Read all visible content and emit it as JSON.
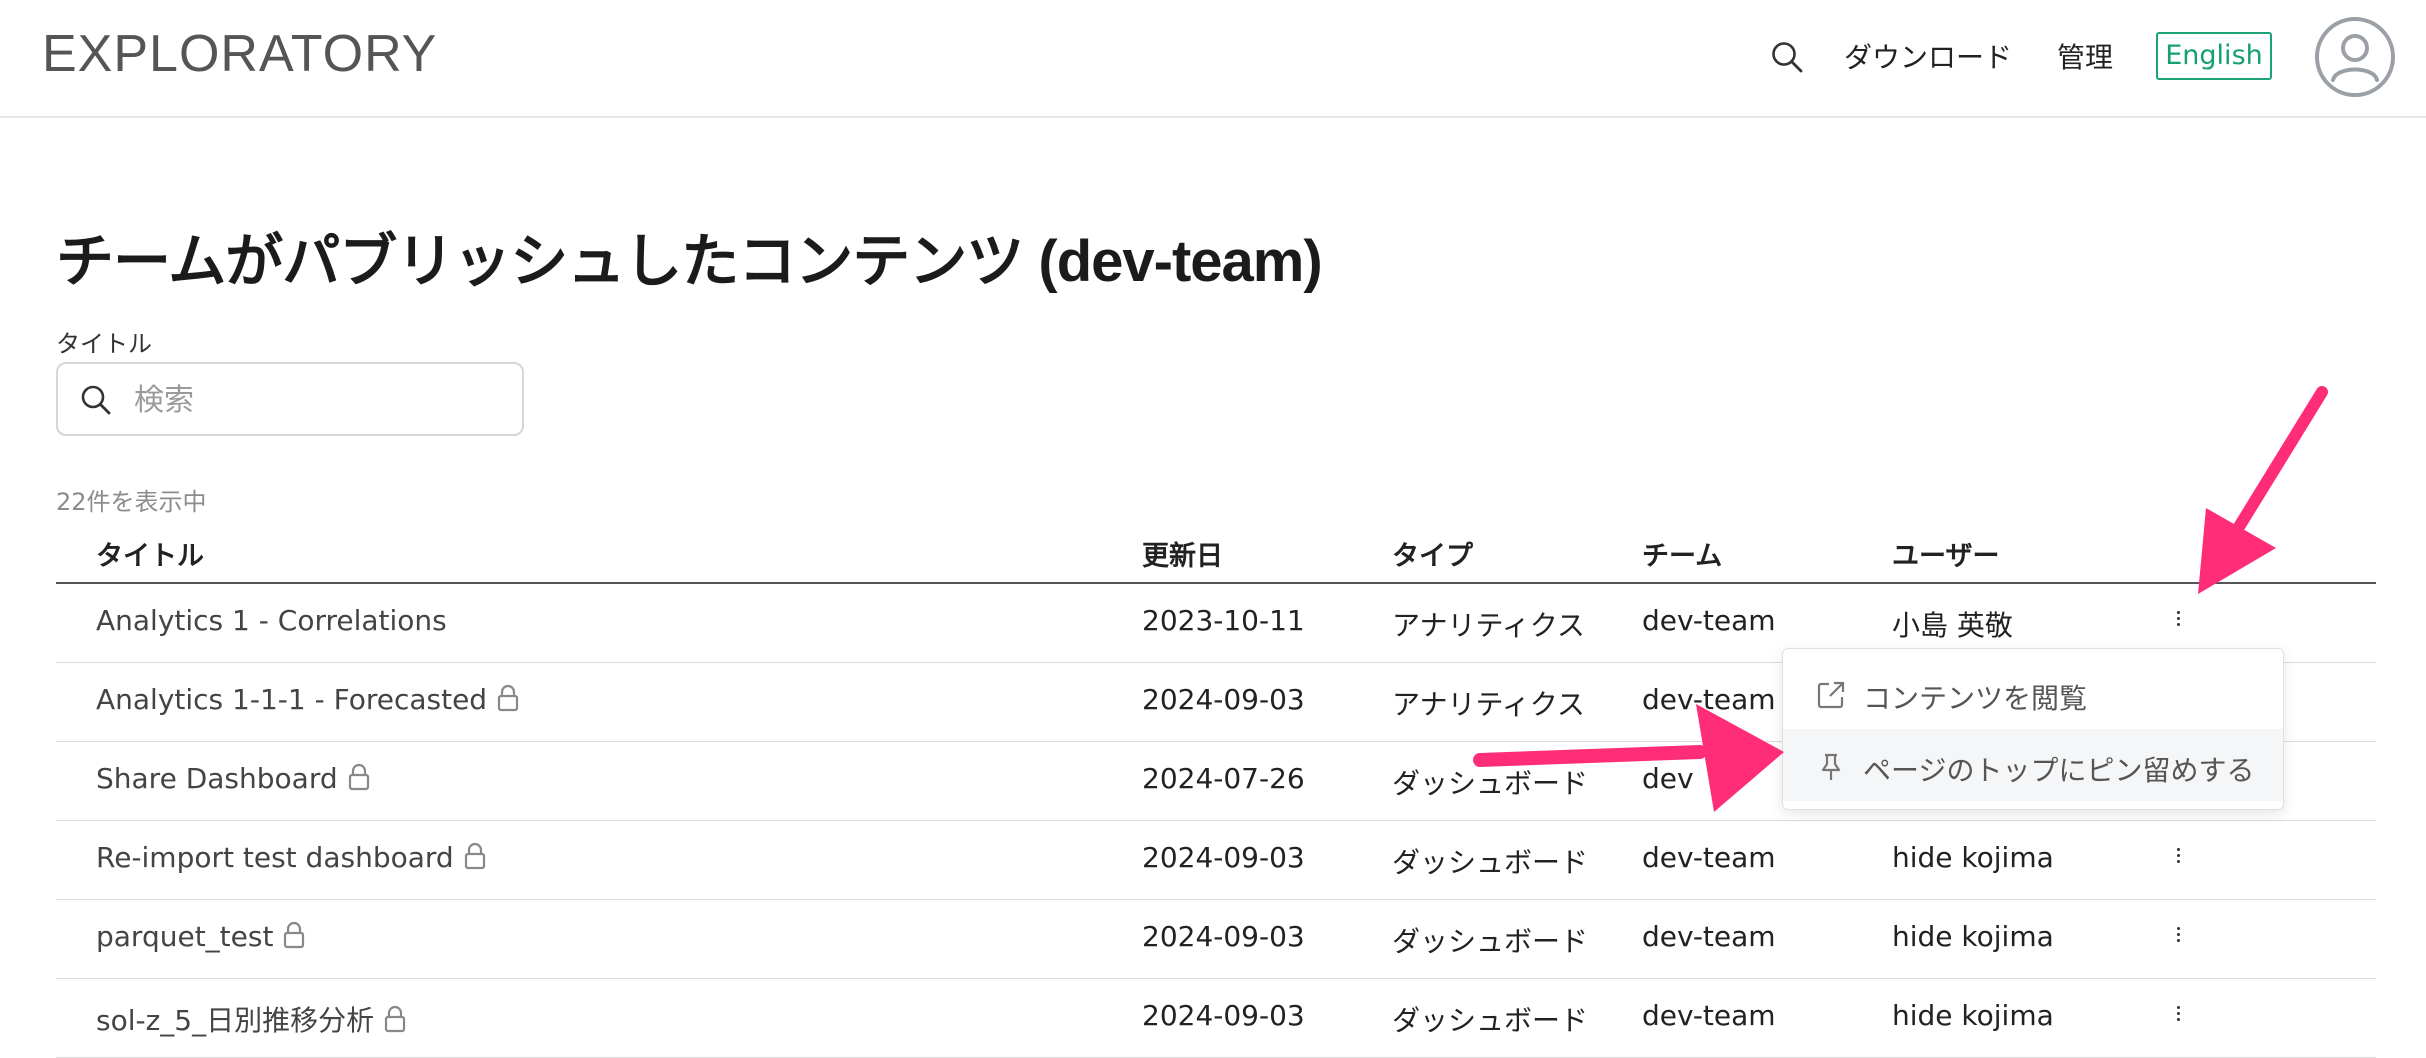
{
  "header": {
    "logo": "EXPLORATORY",
    "nav": {
      "search_icon": "search-icon",
      "download_label": "ダウンロード",
      "admin_label": "管理",
      "language_button": "English",
      "avatar_icon": "user-avatar-icon"
    }
  },
  "page": {
    "title": "チームがパブリッシュしたコンテンツ (dev-team)",
    "filter_label": "タイトル",
    "search_placeholder": "検索",
    "count_text": "22件を表示中"
  },
  "table": {
    "columns": [
      "タイトル",
      "更新日",
      "タイプ",
      "チーム",
      "ユーザー"
    ],
    "rows": [
      {
        "title": "Analytics 1 - Correlations",
        "locked": false,
        "date": "2023-10-11",
        "type": "アナリティクス",
        "team": "dev-team",
        "user": "小島 英敬"
      },
      {
        "title": "Analytics 1-1-1 - Forecasted",
        "locked": true,
        "date": "2024-09-03",
        "type": "アナリティクス",
        "team": "dev-team",
        "user": ""
      },
      {
        "title": "Share Dashboard",
        "locked": true,
        "date": "2024-07-26",
        "type": "ダッシュボード",
        "team": "dev",
        "user": ""
      },
      {
        "title": "Re-import test dashboard",
        "locked": true,
        "date": "2024-09-03",
        "type": "ダッシュボード",
        "team": "dev-team",
        "user": "hide kojima"
      },
      {
        "title": "parquet_test",
        "locked": true,
        "date": "2024-09-03",
        "type": "ダッシュボード",
        "team": "dev-team",
        "user": "hide kojima"
      },
      {
        "title": "sol-z_5_日別推移分析",
        "locked": true,
        "date": "2024-09-03",
        "type": "ダッシュボード",
        "team": "dev-team",
        "user": "hide kojima"
      }
    ]
  },
  "context_menu": {
    "items": [
      {
        "icon": "external-link-icon",
        "label": "コンテンツを閲覧"
      },
      {
        "icon": "pin-icon",
        "label": "ページのトップにピン留めする"
      }
    ]
  },
  "colors": {
    "accent_green": "#17a06f",
    "annotation_pink": "#ff2d78"
  }
}
